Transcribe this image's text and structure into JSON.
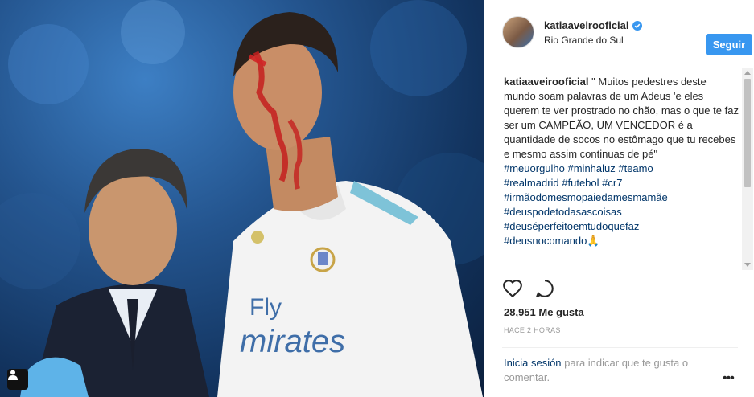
{
  "post": {
    "username": "katiaaveirooficial",
    "location": "Rio Grande do Sul",
    "follow_label": "Seguir",
    "caption_text": "\" Muitos pedestres deste mundo soam palavras de um Adeus 'e eles querem te ver prostrado no chão, mas o que te faz ser um CAMPEÃO, UM VENCEDOR é a quantidade de socos no estômago que tu recebes e mesmo assim continuas de pé\"",
    "hashtags": [
      "#meuorgulho #minhaluz #teamo",
      "#realmadrid #futebol #cr7",
      "#irmãodomesmopaiedamesmamãe",
      "#deuspodetodasascoisas",
      "#deuséperfeitoemtudoquefaz",
      "#deusnocomando🙏"
    ],
    "likes": "28,951 Me gusta",
    "time_ago": "HACE 2 HORAS",
    "login_link": "Inicia sesión",
    "login_rest": " para indicar que te gusta o comentar.",
    "more_label": "•••"
  },
  "photo": {
    "jersey_sponsor_line1": "Fly",
    "jersey_sponsor_line2": "mirates"
  },
  "icons": [
    "user-tag-icon",
    "verified-icon",
    "heart-icon",
    "comment-icon",
    "more-options-icon"
  ],
  "colors": {
    "accent": "#3897f0",
    "link": "#003569",
    "muted": "#999999"
  }
}
